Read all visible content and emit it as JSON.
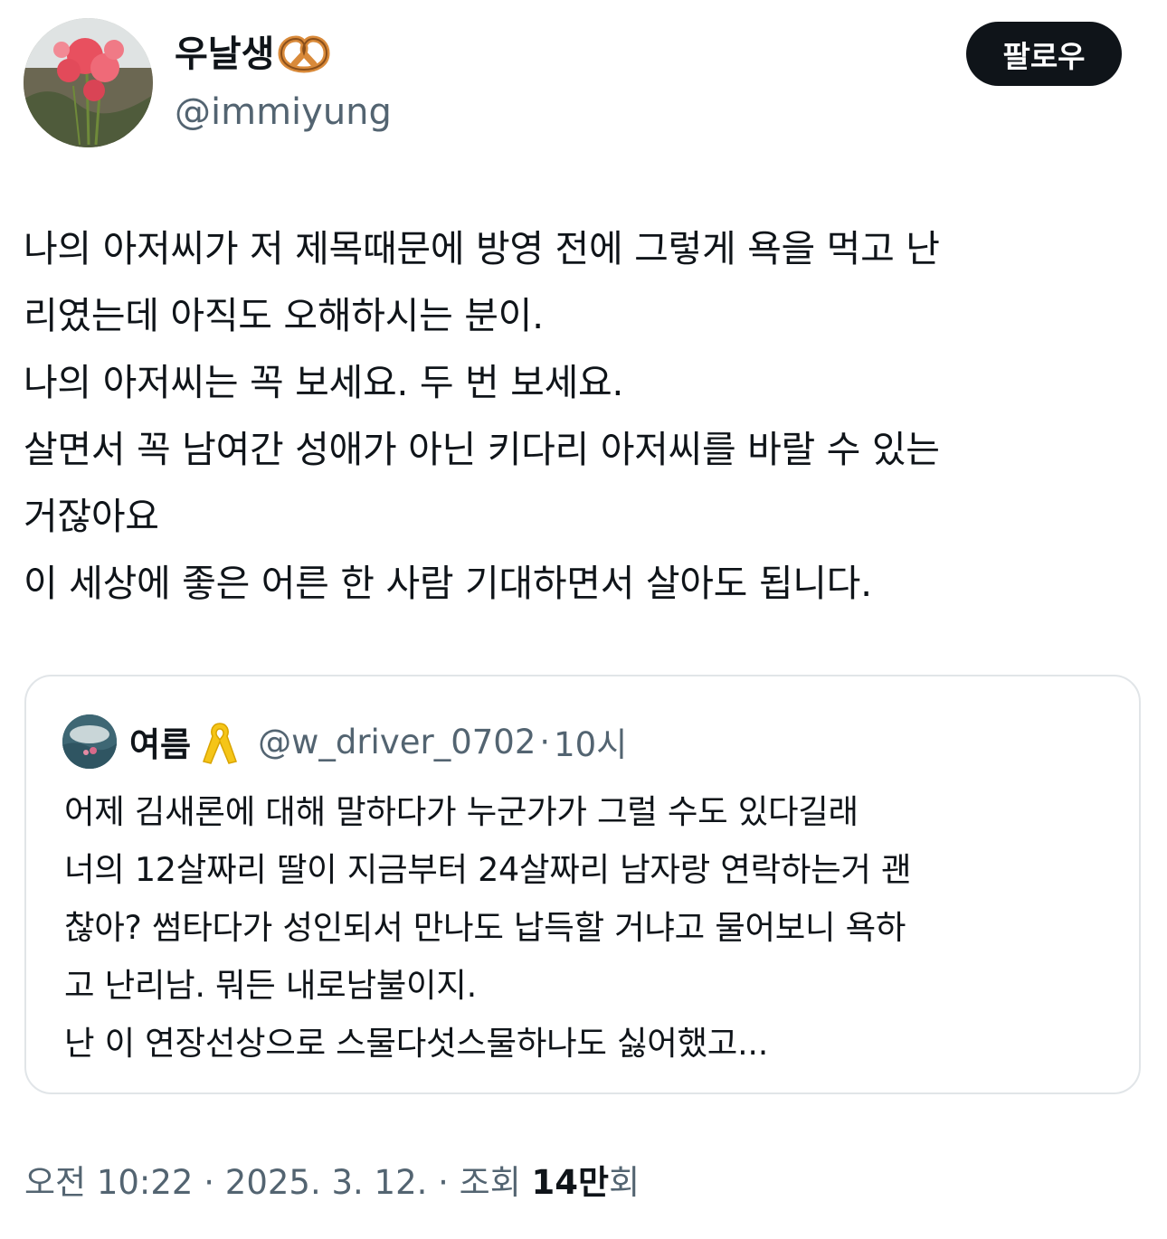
{
  "author": {
    "display_name": "우날생",
    "handle": "@immiyung"
  },
  "follow_button": {
    "label": "팔로우"
  },
  "post": {
    "lines": [
      "나의 아저씨가 저 제목때문에 방영 전에 그렇게 욕을 먹고 난",
      "리였는데 아직도 오해하시는 분이.",
      "나의 아저씨는 꼭 보세요. 두 번 보세요.",
      "살면서 꼭 남여간 성애가 아닌 키다리 아저씨를 바랄 수 있는",
      "거잖아요",
      "이 세상에 좋은 어른 한 사람 기대하면서 살아도 됩니다."
    ]
  },
  "quoted_post": {
    "author_name": "여름",
    "handle": "@w_driver_0702",
    "separator": "·",
    "time": "10시",
    "lines": [
      "어제 김새론에 대해 말하다가 누군가가 그럴 수도 있다길래",
      "너의 12살짜리 딸이 지금부터  24살짜리 남자랑 연락하는거 괜",
      "찮아? 썸타다가 성인되서 만나도 납득할 거냐고 물어보니 욕하",
      "고 난리남. 뭐든 내로남불이지.",
      "난 이 연장선상으로 스물다섯스물하나도 싫어했고..."
    ]
  },
  "meta": {
    "time": "오전 10:22",
    "separator": "·",
    "date": "2025. 3. 12.",
    "views_label": "조회",
    "views_count": "14만",
    "views_suffix": "회"
  },
  "icons": {
    "author_badge": "pretzel-icon",
    "quoted_badge": "yellow-ribbon-icon"
  },
  "colors": {
    "text": "#0f1419",
    "secondary": "#536471",
    "button_bg": "#0f1419",
    "border": "#e1e5e8",
    "ribbon": "#f5c518",
    "pretzel": "#d98a3a"
  }
}
